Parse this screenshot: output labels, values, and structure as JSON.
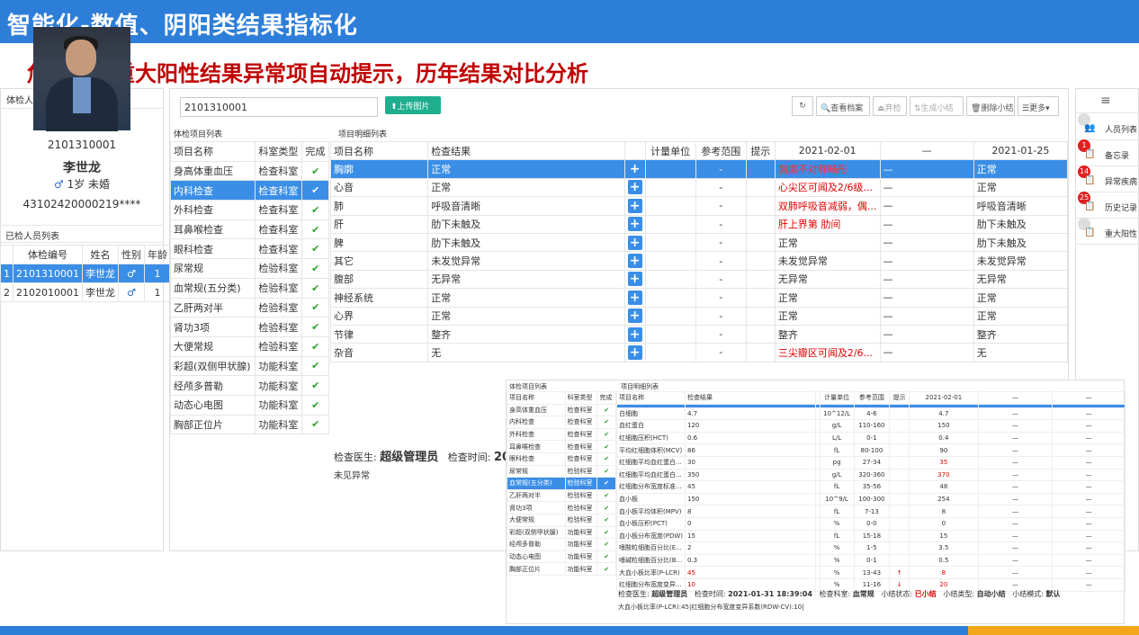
{
  "slide": {
    "title": "智能化-数值、阴阳类结果指标化",
    "subtitle": "危急值、重大阳性结果异常项自动提示，历年结果对比分析"
  },
  "left": {
    "header": "体检人信息",
    "patient_id": "2101310001",
    "name": "李世龙",
    "gender_symbol": "♂",
    "age_status": "1岁 未婚",
    "id_card": "43102420000219****",
    "list_header": "已检人员列表",
    "columns": [
      "",
      "体检编号",
      "姓名",
      "性别",
      "年龄"
    ],
    "rows": [
      {
        "n": "1",
        "id": "2101310001",
        "name": "李世龙",
        "g": "♂",
        "age": "1"
      },
      {
        "n": "2",
        "id": "2102010001",
        "name": "李世龙",
        "g": "♂",
        "age": "1"
      }
    ]
  },
  "toolbar": {
    "search_value": "2101310001",
    "upload": "⬆上传图片",
    "refresh": "↻",
    "view": "查看档案",
    "abandon": "弃检",
    "gen": "生成小结",
    "del": "删除小结",
    "more": "更多▾"
  },
  "sections": {
    "items": "体检项目列表",
    "details": "项目明细列表"
  },
  "items": {
    "columns": [
      "项目名称",
      "科室类型",
      "完成"
    ],
    "rows": [
      [
        "身高体重血压",
        "检查科室"
      ],
      [
        "内科检查",
        "检查科室"
      ],
      [
        "外科检查",
        "检查科室"
      ],
      [
        "耳鼻喉检查",
        "检查科室"
      ],
      [
        "眼科检查",
        "检查科室"
      ],
      [
        "尿常规",
        "检验科室"
      ],
      [
        "血常规(五分类)",
        "检验科室"
      ],
      [
        "乙肝两对半",
        "检验科室"
      ],
      [
        "肾功3项",
        "检验科室"
      ],
      [
        "大便常规",
        "检验科室"
      ],
      [
        "彩超(双侧甲状腺)",
        "功能科室"
      ],
      [
        "经颅多普勒",
        "功能科室"
      ],
      [
        "动态心电图",
        "功能科室"
      ],
      [
        "胸部正位片",
        "功能科室"
      ]
    ]
  },
  "details": {
    "columns": [
      "项目名称",
      "检查结果",
      "",
      "计量单位",
      "参考范围",
      "提示",
      "2021-02-01",
      "—",
      "2021-01-25"
    ],
    "rows": [
      {
        "name": "胸廓",
        "result": "正常",
        "range": "-",
        "h1": "胸廓不对称畸形",
        "h2": "—",
        "h3": "正常",
        "red": true
      },
      {
        "name": "心音",
        "result": "正常",
        "range": "-",
        "h1": "心尖区可闻及2/6级...",
        "h2": "—",
        "h3": "正常",
        "red": true
      },
      {
        "name": "肺",
        "result": "呼吸音清晰",
        "range": "-",
        "h1": "双肺呼吸音减弱，偶...",
        "h2": "—",
        "h3": "呼吸音清晰",
        "red": true
      },
      {
        "name": "肝",
        "result": "肋下未触及",
        "range": "-",
        "h1": "肝上界第 肋间",
        "h2": "—",
        "h3": "肋下未触及",
        "red": true
      },
      {
        "name": "脾",
        "result": "肋下未触及",
        "range": "-",
        "h1": "正常",
        "h2": "—",
        "h3": "肋下未触及",
        "red": false
      },
      {
        "name": "其它",
        "result": "未发觉异常",
        "range": "-",
        "h1": "未发觉异常",
        "h2": "—",
        "h3": "未发觉异常",
        "red": false
      },
      {
        "name": "腹部",
        "result": "无异常",
        "range": "-",
        "h1": "无异常",
        "h2": "—",
        "h3": "无异常",
        "red": false
      },
      {
        "name": "神经系统",
        "result": "正常",
        "range": "-",
        "h1": "正常",
        "h2": "—",
        "h3": "正常",
        "red": false
      },
      {
        "name": "心界",
        "result": "正常",
        "range": "-",
        "h1": "正常",
        "h2": "—",
        "h3": "正常",
        "red": false
      },
      {
        "name": "节律",
        "result": "整齐",
        "range": "-",
        "h1": "整齐",
        "h2": "—",
        "h3": "整齐",
        "red": false
      },
      {
        "name": "杂音",
        "result": "无",
        "range": "-",
        "h1": "三尖瓣区可闻及2/6...",
        "h2": "—",
        "h3": "无",
        "red": true
      }
    ]
  },
  "doctor": {
    "label": "检查医生:",
    "name": "超级管理员",
    "time_label": "检查时间:",
    "time": "20"
  },
  "note": "未见异常",
  "rightnav": [
    {
      "icon": "👥",
      "label": "人员列表",
      "badge": "0"
    },
    {
      "icon": "📋",
      "label": "备忘录",
      "badge": "1"
    },
    {
      "icon": "📋",
      "label": "异常疾病",
      "badge": "14"
    },
    {
      "icon": "📋",
      "label": "历史记录",
      "badge": "25"
    },
    {
      "icon": "📋",
      "label": "重大阳性",
      "badge": "0"
    }
  ],
  "inset": {
    "sec1": "体检项目列表",
    "sec2": "项目明细列表",
    "icols": [
      "项目名称",
      "科室类型",
      "完成"
    ],
    "irows": [
      [
        "身高体重血压",
        "检查科室"
      ],
      [
        "内科检查",
        "检查科室"
      ],
      [
        "外科检查",
        "检查科室"
      ],
      [
        "耳鼻喉检查",
        "检查科室"
      ],
      [
        "眼科检查",
        "检查科室"
      ],
      [
        "尿常规",
        "检验科室"
      ],
      [
        "血常规(五分类)",
        "检验科室"
      ],
      [
        "乙肝两对半",
        "检验科室"
      ],
      [
        "肾功3项",
        "检验科室"
      ],
      [
        "大便常规",
        "检验科室"
      ],
      [
        "彩超(双侧甲状腺)",
        "功能科室"
      ],
      [
        "经颅多普勒",
        "功能科室"
      ],
      [
        "动态心电图",
        "功能科室"
      ],
      [
        "胸部正位片",
        "功能科室"
      ]
    ],
    "dcols": [
      "项目名称",
      "检查结果",
      "",
      "计量单位",
      "参考范围",
      "提示",
      "2021-02-01",
      "—",
      "—"
    ],
    "drows": [
      [
        "白细胞",
        "4.7",
        "10^12/L",
        "4-6",
        "",
        "4.7",
        "—",
        "—",
        ""
      ],
      [
        "血红蛋白",
        "120",
        "g/L",
        "110-160",
        "",
        "150",
        "—",
        "—",
        ""
      ],
      [
        "红细胞压积(HCT)",
        "0.6",
        "L/L",
        "0-1",
        "",
        "0.4",
        "—",
        "—",
        ""
      ],
      [
        "平均红细胞体积(MCV)",
        "86",
        "fL",
        "80-100",
        "",
        "90",
        "—",
        "—",
        ""
      ],
      [
        "红细胞平均血红蛋白...",
        "30",
        "pg",
        "27-34",
        "",
        "35",
        "—",
        "—",
        "r"
      ],
      [
        "红细胞平均血红蛋白...",
        "350",
        "g/L",
        "320-360",
        "",
        "370",
        "—",
        "—",
        "r"
      ],
      [
        "红细胞分布宽度标准...",
        "45",
        "fL",
        "35-56",
        "",
        "48",
        "—",
        "—",
        ""
      ],
      [
        "血小板",
        "150",
        "10^9/L",
        "100-300",
        "",
        "254",
        "—",
        "—",
        ""
      ],
      [
        "血小板平均体积(MPV)",
        "8",
        "fL",
        "7-13",
        "",
        "8",
        "—",
        "—",
        ""
      ],
      [
        "血小板压积(PCT)",
        "0",
        "%",
        "0-0",
        "",
        "0",
        "—",
        "—",
        ""
      ],
      [
        "血小板分布宽度(PDW)",
        "15",
        "fL",
        "15-18",
        "",
        "15",
        "—",
        "—",
        ""
      ],
      [
        "嗜酸粒细胞百分比(E...",
        "2",
        "%",
        "1-5",
        "",
        "3.5",
        "—",
        "—",
        ""
      ],
      [
        "嗜碱粒细胞百分比(B...",
        "0.3",
        "%",
        "0-1",
        "",
        "0.5",
        "—",
        "—",
        ""
      ],
      [
        "大血小板比率(P-LCR)",
        "45",
        "%",
        "13-43",
        "↑",
        "8",
        "—",
        "—",
        "r"
      ],
      [
        "红细胞分布宽度变异...",
        "10",
        "%",
        "11-16",
        "↓",
        "20",
        "—",
        "—",
        "r"
      ]
    ],
    "foot_doctor_label": "检查医生:",
    "foot_doctor": "超级管理员",
    "foot_time_label": "检查时间:",
    "foot_time": "2021-01-31 18:39:04",
    "foot_dept_label": "检查科室:",
    "foot_dept": "血常规",
    "foot_status_label": "小结状态:",
    "foot_status": "已小结",
    "foot_type_label": "小结类型:",
    "foot_type": "自动小结",
    "foot_mode_label": "小结模式:",
    "foot_mode": "默认",
    "summary": "大血小板比率(P-LCR):45|红细胞分布宽度变异系数(RDW-CV):10|"
  },
  "colors": {
    "accent": "#3a8ee6",
    "danger": "#e00000",
    "ok": "#2aa12a",
    "brand": "#2d7ed8",
    "upload": "#1fae8e"
  }
}
